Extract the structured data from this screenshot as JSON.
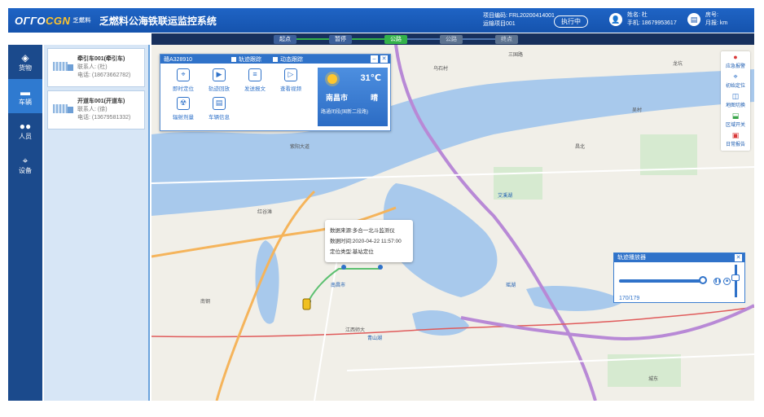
{
  "header": {
    "logo_main": "ОГГО",
    "logo_accent": "CGN",
    "logo_sub": "乏燃料",
    "title": "乏燃料公海铁联运监控系统",
    "project_code": "项目编码: FRL20200414001",
    "transport_code": "运输项目001",
    "status": "执行中",
    "user_name": "姓名: 杜",
    "user_phone": "手机: 18679953617",
    "extra_1": "房号:",
    "extra_2": "月报: km"
  },
  "nav": {
    "items": [
      {
        "label": "货物",
        "icon": "cube-icon"
      },
      {
        "label": "车辆",
        "icon": "truck-icon"
      },
      {
        "label": "人员",
        "icon": "people-icon"
      },
      {
        "label": "设备",
        "icon": "satellite-icon"
      }
    ]
  },
  "vehicles": [
    {
      "name": "牵引车001(牵引车)",
      "contact": "联系人: (杜)",
      "phone": "电话: (18673662782)"
    },
    {
      "name": "开道车001(开道车)",
      "contact": "联系人: (徐)",
      "phone": "电话: (13679581332)"
    }
  ],
  "controls": {
    "buttons": [
      {
        "label": "起点"
      },
      {
        "label": "暂停"
      },
      {
        "label": "公路"
      },
      {
        "label": "公路"
      },
      {
        "label": "终点"
      }
    ]
  },
  "popup": {
    "plate": "赣A328910",
    "check_1": "轨迹跟踪",
    "check_2": "动态跟踪",
    "tools": [
      {
        "label": "即时定位",
        "icon": "location-icon"
      },
      {
        "label": "轨迹回放",
        "icon": "play-icon"
      },
      {
        "label": "发送报文",
        "icon": "message-icon"
      },
      {
        "label": "查看视频",
        "icon": "video-icon"
      },
      {
        "label": "辐射剂量",
        "icon": "radiation-icon"
      },
      {
        "label": "车辆信息",
        "icon": "car-info-icon"
      }
    ],
    "weather": {
      "temp": "31℃",
      "city": "南昌市",
      "condition": "晴",
      "road": "路通闭段(国新二段路)"
    }
  },
  "maptools": [
    {
      "label": "应急报警",
      "icon": "pin-icon"
    },
    {
      "label": "初始定位",
      "icon": "locate-icon"
    },
    {
      "label": "地图切换",
      "icon": "layers-icon"
    },
    {
      "label": "区域开关",
      "icon": "area-icon"
    },
    {
      "label": "日常报告",
      "icon": "report-icon"
    }
  ],
  "info": {
    "source": "数据来源:多合一北斗监测仪",
    "time": "数据时间:2020-04-22 11:57:00",
    "type": "定位类型:基站定位"
  },
  "player": {
    "title": "轨迹播放器",
    "counter": "170/179",
    "progress": 0.95
  },
  "map_labels": {
    "l1": "三国路",
    "l2": "乌石村",
    "l3": "龙坑",
    "l4": "紫阳大道",
    "l5": "红谷滩",
    "l6": "南昌市",
    "l7": "青山湖",
    "l8": "瑶湖",
    "l9": "艾溪湖",
    "l10": "江西师大",
    "l11": "吴村",
    "l12": "昌北",
    "l13": "南钢",
    "l14": "城东"
  }
}
